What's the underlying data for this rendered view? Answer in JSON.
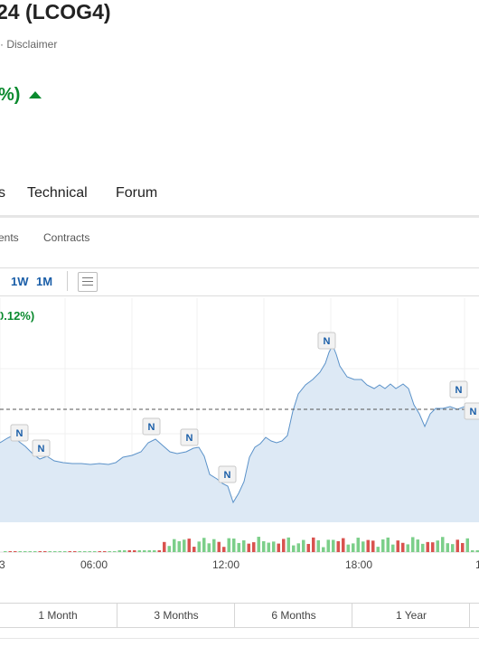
{
  "header": {
    "title": "24 (LCOG4)",
    "meta": "· Disclaimer",
    "change": "%)",
    "colors": {
      "up": "#0a8a2e",
      "link": "#1a5ea8"
    }
  },
  "tabs": [
    "s",
    "Technical",
    "Forum"
  ],
  "subtabs": [
    "ents",
    "Contracts"
  ],
  "ranges": [
    "1W",
    "1M"
  ],
  "chart_toolbar": {
    "icons": [
      "table-icon"
    ]
  },
  "chart_data": {
    "type": "line",
    "change_label": "0.12%)",
    "x": [
      "03:00",
      "04:00",
      "05:00",
      "06:00",
      "07:00",
      "08:00",
      "09:00",
      "10:00",
      "11:00",
      "12:00",
      "13:00",
      "14:00",
      "15:00",
      "16:00",
      "17:00",
      "18:00",
      "19:00",
      "20:00",
      "21:00"
    ],
    "xticks": [
      "3",
      "06:00",
      "12:00",
      "18:00",
      "1"
    ],
    "reference_line": "previous close (dashed)",
    "news_markers": {
      "label": "N",
      "count": 8
    },
    "volume_colors": {
      "up": "#7ccf8a",
      "down": "#d9534f"
    }
  },
  "periods": [
    "1 Month",
    "3 Months",
    "6 Months",
    "1 Year"
  ]
}
